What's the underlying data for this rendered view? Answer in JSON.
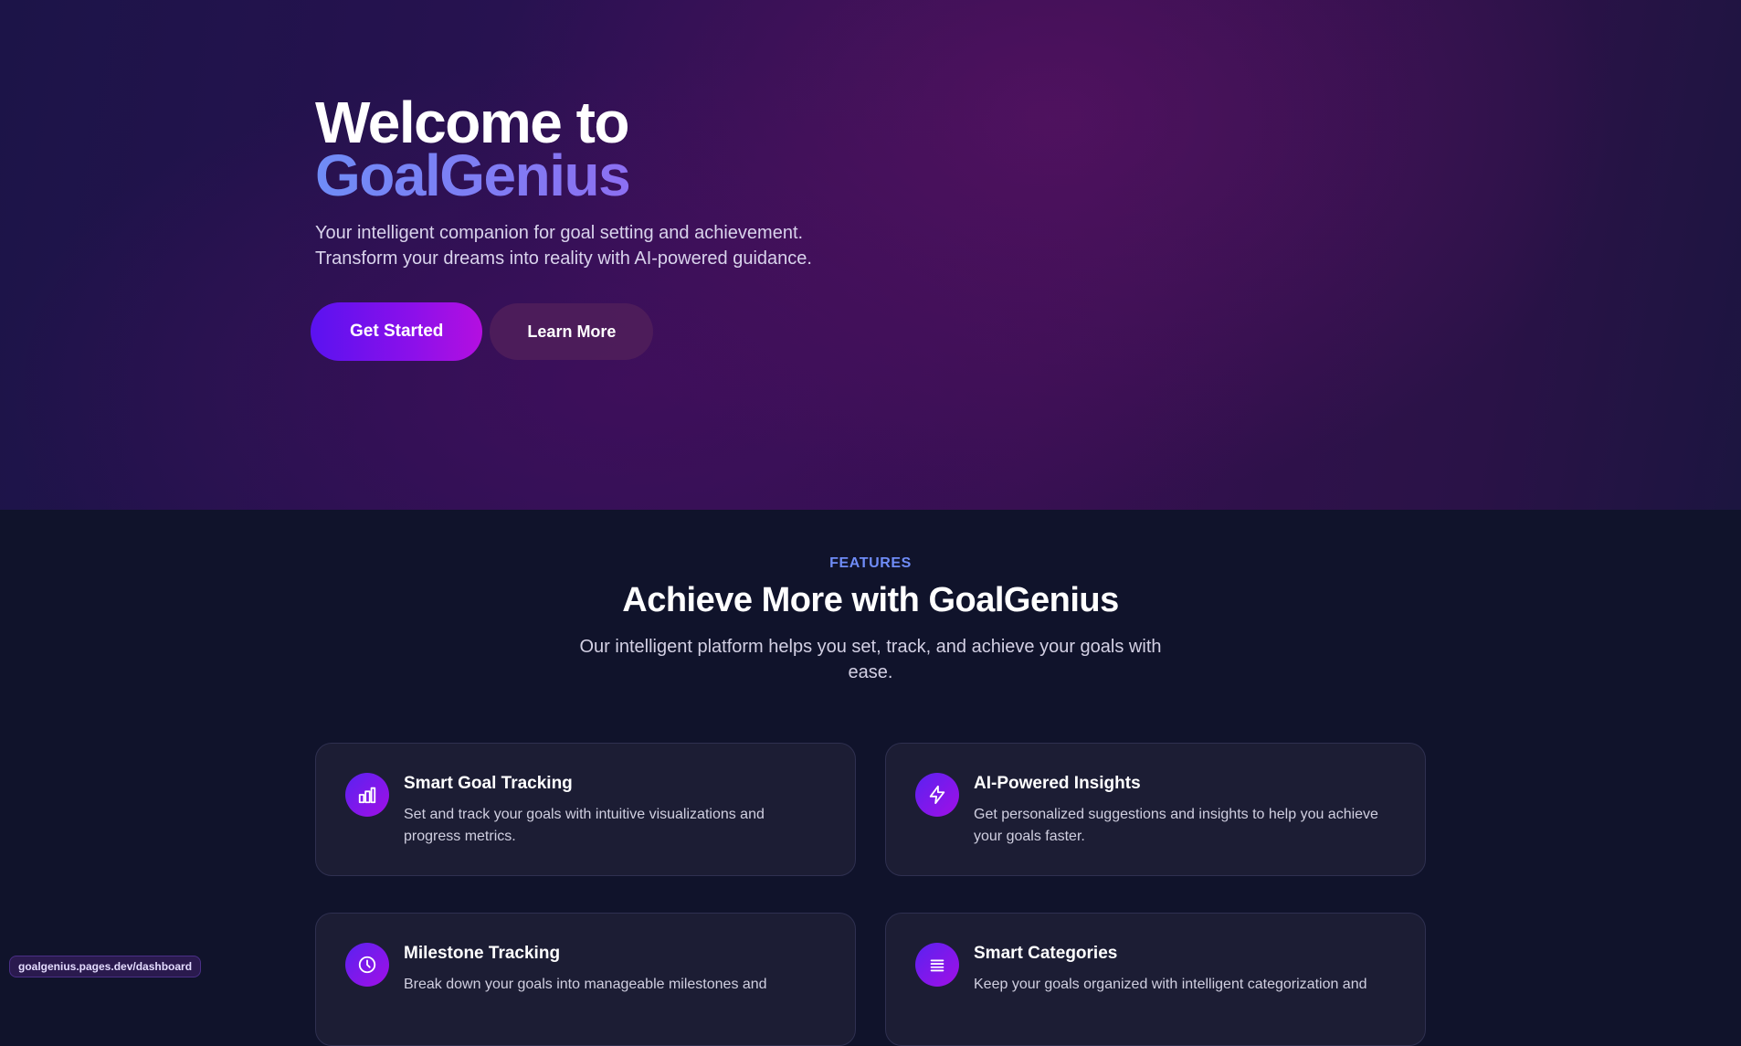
{
  "hero": {
    "title_line1": "Welcome to",
    "title_brand": "GoalGenius",
    "subtitle": "Your intelligent companion for goal setting and achievement. Transform your dreams into reality with AI-powered guidance.",
    "primary_button": "Get Started",
    "secondary_button": "Learn More"
  },
  "features": {
    "eyebrow": "FEATURES",
    "title": "Achieve More with GoalGenius",
    "subtitle": "Our intelligent platform helps you set, track, and achieve your goals with ease.",
    "cards": [
      {
        "icon": "bar-chart-icon",
        "title": "Smart Goal Tracking",
        "description": "Set and track your goals with intuitive visualizations and progress metrics."
      },
      {
        "icon": "lightning-icon",
        "title": "AI-Powered Insights",
        "description": "Get personalized suggestions and insights to help you achieve your goals faster."
      },
      {
        "icon": "clock-icon",
        "title": "Milestone Tracking",
        "description": "Break down your goals into manageable milestones and"
      },
      {
        "icon": "list-icon",
        "title": "Smart Categories",
        "description": "Keep your goals organized with intelligent categorization and"
      }
    ]
  },
  "status_bar": {
    "url": "goalgenius.pages.dev/dashboard"
  },
  "colors": {
    "accent_blue": "#6f8cf7",
    "accent_purple": "#8c10ea",
    "page_background": "#10132b",
    "card_background": "#1c1d34"
  }
}
